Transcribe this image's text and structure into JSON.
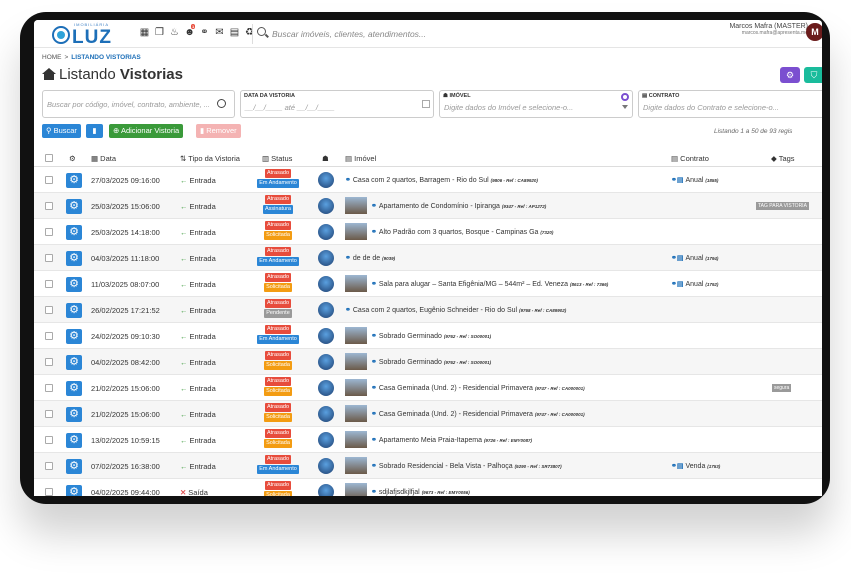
{
  "header": {
    "logo_sub": "IMOBILIÁRIA",
    "logo_text": "LUZ",
    "search_placeholder": "Buscar imóveis, clientes, atendimentos...",
    "user_name": "Marcos Mafra (MASTER)",
    "user_email": "marcos.mafra@apresenta.me",
    "user_initial": "M",
    "notification_count": "1"
  },
  "breadcrumb": {
    "home": "HOME",
    "separator": ">",
    "current": "LISTANDO VISTORIAS"
  },
  "title": {
    "prefix": "Listando",
    "bold": "Vistorias"
  },
  "filters": {
    "search_placeholder": "Buscar por código, imóvel, contrato, ambiente, ...",
    "date_label": "DATA DA VISTORIA",
    "date_placeholder": "__/__/____ até __/__/____",
    "imovel_label": "IMÓVEL",
    "imovel_placeholder": "Digite dados do Imóvel e selecione-o...",
    "contrato_label": "CONTRATO",
    "contrato_placeholder": "Digite dados do Contrato e selecione-o..."
  },
  "buttons": {
    "search": "Buscar",
    "add": "Adicionar Vistoria",
    "remove": "Remover"
  },
  "records_text": "Listando 1 a 50 de 93 regis",
  "columns": {
    "date": "Data",
    "type": "Tipo da Vistoria",
    "status": "Status",
    "imovel": "Imóvel",
    "contrato": "Contrato",
    "tags": "Tags"
  },
  "colors": {
    "primary": "#2b86d6",
    "green": "#3a9a3a",
    "danger": "#e05555",
    "late": "#e74c3c",
    "progress": "#2b86d6",
    "solicitada": "#f39c12",
    "assinatura": "#2b86d6",
    "pendente": "#9a9a9a",
    "purple": "#7b4fd0",
    "teal": "#1abc9c"
  },
  "rows": [
    {
      "date": "27/03/2025 09:16:00",
      "type": "Entrada",
      "s1": "Atrasado",
      "s2": "Em Andamento",
      "s2c": "#2b86d6",
      "imovel": "Casa com 2 quartos, Barragem - Rio do Sul",
      "ref": "(9806 - Ref : CA89920)",
      "thumb": false,
      "contrato": "Anual",
      "cref": "(1855)",
      "tag": ""
    },
    {
      "date": "25/03/2025 15:06:00",
      "type": "Entrada",
      "s1": "Atrasado",
      "s2": "Assinatura",
      "s2c": "#2b86d6",
      "imovel": "Apartamento de Condomínio - Ipiranga",
      "ref": "(9347 - Ref : AP1272)",
      "thumb": true,
      "contrato": "",
      "cref": "",
      "tag": "TAG PARA VISTORIA"
    },
    {
      "date": "25/03/2025 14:18:00",
      "type": "Entrada",
      "s1": "Atrasado",
      "s2": "Solicitada",
      "s2c": "#f39c12",
      "imovel": "Alto Padrão com 3 quartos, Bosque - Campinas Ga",
      "ref": "(7320)",
      "thumb": true,
      "contrato": "",
      "cref": "",
      "tag": ""
    },
    {
      "date": "04/03/2025 11:18:00",
      "type": "Entrada",
      "s1": "Atrasado",
      "s2": "Em Andamento",
      "s2c": "#2b86d6",
      "imovel": "de de de",
      "ref": "(9039)",
      "thumb": false,
      "contrato": "Anual",
      "cref": "(1794)",
      "tag": ""
    },
    {
      "date": "11/03/2025 08:07:00",
      "type": "Entrada",
      "s1": "Atrasado",
      "s2": "Solicitada",
      "s2c": "#f39c12",
      "imovel": "Sala para alugar – Santa Efigênia/MG – 544m² – Ed. Veneza",
      "ref": "(8613 - Ref : 7366)",
      "thumb": true,
      "contrato": "Anual",
      "cref": "(1792)",
      "tag": ""
    },
    {
      "date": "26/02/2025 17:21:52",
      "type": "Entrada",
      "s1": "Atrasado",
      "s2": "Pendente",
      "s2c": "#9a9a9a",
      "imovel": "Casa com 2 quartos, Eugênio Schneider - Rio do Sul",
      "ref": "(9768 - Ref : CA89902)",
      "thumb": false,
      "contrato": "",
      "cref": "",
      "tag": ""
    },
    {
      "date": "24/02/2025 09:10:30",
      "type": "Entrada",
      "s1": "Atrasado",
      "s2": "Em Andamento",
      "s2c": "#2b86d6",
      "imovel": "Sobrado Germinado",
      "ref": "(9762 - Ref : SO00001)",
      "thumb": true,
      "contrato": "",
      "cref": "",
      "tag": ""
    },
    {
      "date": "04/02/2025 08:42:00",
      "type": "Entrada",
      "s1": "Atrasado",
      "s2": "Solicitada",
      "s2c": "#f39c12",
      "imovel": "Sobrado Germinado",
      "ref": "(9762 - Ref : SO00001)",
      "thumb": true,
      "contrato": "",
      "cref": "",
      "tag": ""
    },
    {
      "date": "21/02/2025 15:06:00",
      "type": "Entrada",
      "s1": "Atrasado",
      "s2": "Solicitada",
      "s2c": "#f39c12",
      "imovel": "Casa Geminada (Und. 2) - Residencial Primavera",
      "ref": "(9747 - Ref : CA000001)",
      "thumb": true,
      "contrato": "",
      "cref": "",
      "tag": "segura"
    },
    {
      "date": "21/02/2025 15:06:00",
      "type": "Entrada",
      "s1": "Atrasado",
      "s2": "Solicitada",
      "s2c": "#f39c12",
      "imovel": "Casa Geminada (Und. 2) - Residencial Primavera",
      "ref": "(9747 - Ref : CA000001)",
      "thumb": true,
      "contrato": "",
      "cref": "",
      "tag": ""
    },
    {
      "date": "13/02/2025 10:59:15",
      "type": "Entrada",
      "s1": "Atrasado",
      "s2": "Solicitada",
      "s2c": "#f39c12",
      "imovel": "Apartamento Meia Praia-Itapema",
      "ref": "(9726 - Ref : EMY0087)",
      "thumb": true,
      "contrato": "",
      "cref": "",
      "tag": ""
    },
    {
      "date": "07/02/2025 16:38:00",
      "type": "Entrada",
      "s1": "Atrasado",
      "s2": "Em Andamento",
      "s2c": "#2b86d6",
      "imovel": "Sobrado Residencial - Bela Vista - Palhoça",
      "ref": "(9290 - Ref : SR73807)",
      "thumb": true,
      "contrato": "Venda",
      "cref": "(1753)",
      "tag": ""
    },
    {
      "date": "04/02/2025 09:44:00",
      "type": "Saída",
      "s1": "Atrasado",
      "s2": "Solicitada",
      "s2c": "#f39c12",
      "imovel": "sdjlafjsdkjlfjal",
      "ref": "(9673 - Ref : EMY0056)",
      "thumb": true,
      "contrato": "",
      "cref": "",
      "tag": ""
    }
  ]
}
